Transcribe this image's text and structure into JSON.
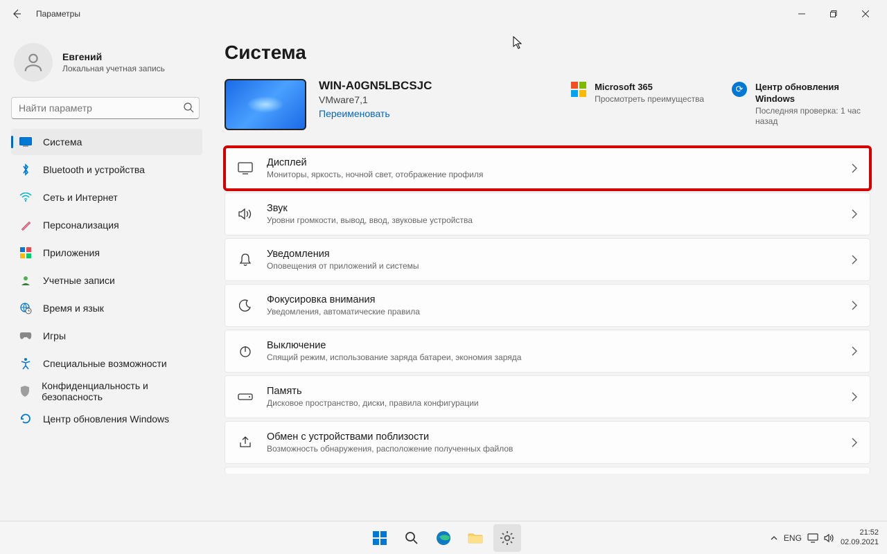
{
  "titlebar": {
    "title": "Параметры"
  },
  "user": {
    "name": "Евгений",
    "subtitle": "Локальная учетная запись"
  },
  "search": {
    "placeholder": "Найти параметр"
  },
  "nav": {
    "items": [
      {
        "label": "Система"
      },
      {
        "label": "Bluetooth и устройства"
      },
      {
        "label": "Сеть и Интернет"
      },
      {
        "label": "Персонализация"
      },
      {
        "label": "Приложения"
      },
      {
        "label": "Учетные записи"
      },
      {
        "label": "Время и язык"
      },
      {
        "label": "Игры"
      },
      {
        "label": "Специальные возможности"
      },
      {
        "label": "Конфиденциальность и безопасность"
      },
      {
        "label": "Центр обновления Windows"
      }
    ]
  },
  "page": {
    "title": "Система",
    "device": {
      "name": "WIN-A0GN5LBCSJC",
      "model": "VMware7,1",
      "rename": "Переименовать"
    },
    "header_actions": {
      "ms365": {
        "title": "Microsoft 365",
        "subtitle": "Просмотреть преимущества"
      },
      "update": {
        "title": "Центр обновления Windows",
        "subtitle": "Последняя проверка: 1 час назад"
      }
    },
    "rows": [
      {
        "title": "Дисплей",
        "subtitle": "Мониторы, яркость, ночной свет, отображение профиля"
      },
      {
        "title": "Звук",
        "subtitle": "Уровни громкости, вывод, ввод, звуковые устройства"
      },
      {
        "title": "Уведомления",
        "subtitle": "Оповещения от приложений и системы"
      },
      {
        "title": "Фокусировка внимания",
        "subtitle": "Уведомления, автоматические правила"
      },
      {
        "title": "Выключение",
        "subtitle": "Спящий режим, использование заряда батареи, экономия заряда"
      },
      {
        "title": "Память",
        "subtitle": "Дисковое пространство, диски, правила конфигурации"
      },
      {
        "title": "Обмен с устройствами поблизости",
        "subtitle": "Возможность обнаружения, расположение полученных файлов"
      }
    ]
  },
  "taskbar": {
    "lang": "ENG",
    "time": "21:52",
    "date": "02.09.2021"
  }
}
